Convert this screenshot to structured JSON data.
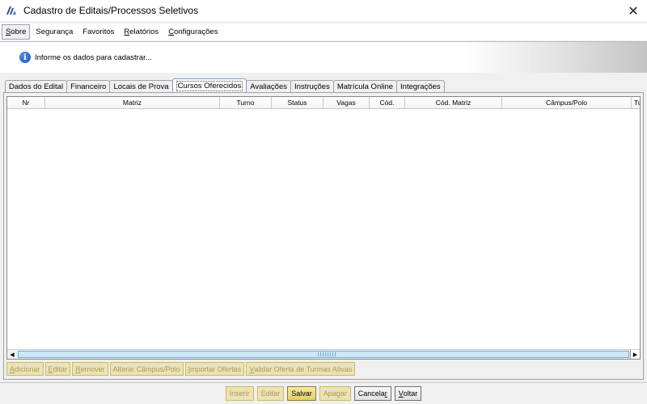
{
  "window": {
    "title": "Cadastro de Editais/Processos Seletivos",
    "close_symbol": "✕"
  },
  "menu": [
    {
      "pre": "",
      "key": "S",
      "post": "obre"
    },
    {
      "pre": "Segurança",
      "key": "",
      "post": ""
    },
    {
      "pre": "Favoritos",
      "key": "",
      "post": ""
    },
    {
      "pre": "",
      "key": "R",
      "post": "elatórios"
    },
    {
      "pre": "",
      "key": "C",
      "post": "onfigurações"
    }
  ],
  "info": {
    "icon": "info-icon",
    "icon_glyph": "i",
    "message": "Informe os dados para cadastrar..."
  },
  "tabs": [
    {
      "label": "Dados do Edital",
      "selected": false
    },
    {
      "label": "Financeiro",
      "selected": false
    },
    {
      "label": "Locais de Prova",
      "selected": false
    },
    {
      "label": "Cursos Oferecidos",
      "selected": true
    },
    {
      "label": "Avaliações",
      "selected": false
    },
    {
      "label": "Instruções",
      "selected": false
    },
    {
      "label": "Matrícula Online",
      "selected": false
    },
    {
      "label": "Integrações",
      "selected": false
    }
  ],
  "table": {
    "columns": [
      "Nr",
      "Matriz",
      "Turno",
      "Status",
      "Vagas",
      "Cód.",
      "Cód. Matriz",
      "Câmpus/Polo",
      "Turma Ativa"
    ],
    "rows": []
  },
  "table_actions": [
    {
      "key": "A",
      "rest": "dicionar",
      "enabled": false
    },
    {
      "key": "E",
      "rest": "ditar",
      "enabled": false
    },
    {
      "key": "R",
      "rest": "emover",
      "enabled": false
    },
    {
      "key": "",
      "rest": "Alterar Câmpus/Polo",
      "enabled": false
    },
    {
      "key": "I",
      "rest": "mportar Ofertas",
      "enabled": false
    },
    {
      "key": "V",
      "rest": "alidar Oferta de Turmas Ativas",
      "enabled": false
    }
  ],
  "footer_buttons": {
    "inserir": "Inserir",
    "editar": "Editar",
    "salvar": "Salvar",
    "apagar": "Apagar",
    "cancelar_pre": "Cancela",
    "cancelar_key": "r",
    "voltar_key": "V",
    "voltar_post": "oltar"
  },
  "colors": {
    "disabled_button_bg": "#ece3b4",
    "primary_button_bg": "#e2cf6a",
    "scroll_thumb": "#cfe6f7"
  }
}
